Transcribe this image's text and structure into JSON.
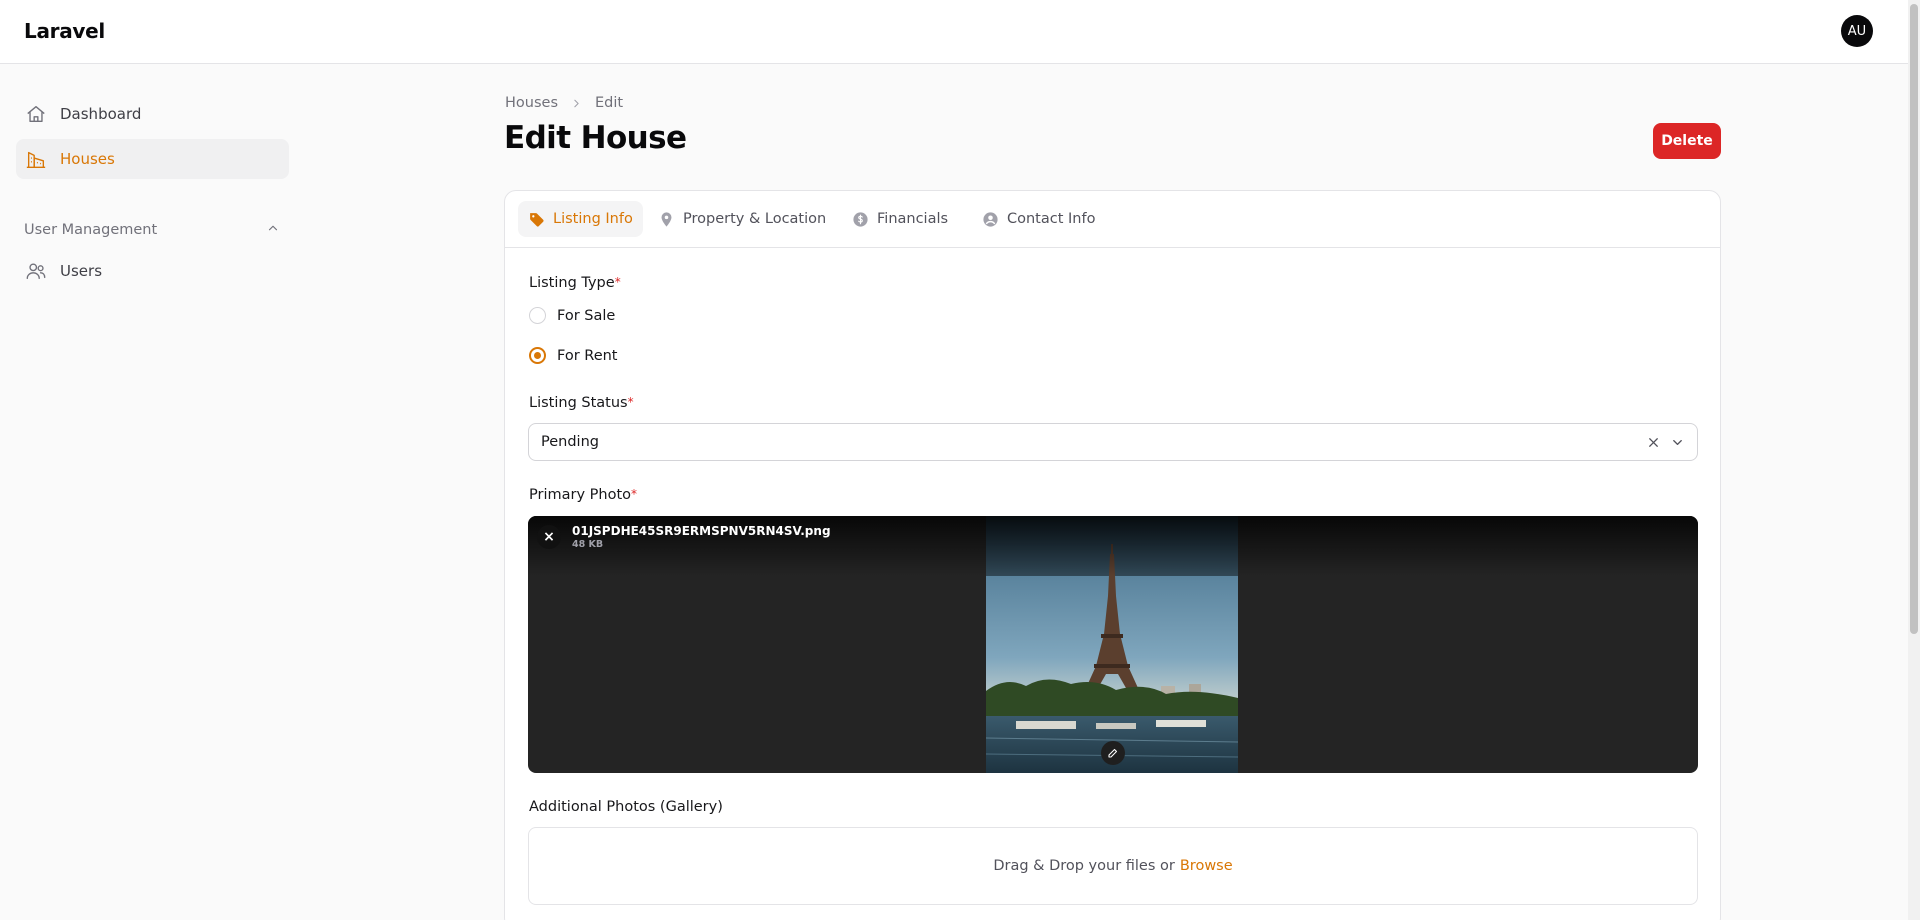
{
  "app": {
    "brand": "Laravel",
    "avatar_initials": "AU"
  },
  "sidebar": {
    "items": [
      {
        "label": "Dashboard",
        "icon": "home-icon",
        "active": false
      },
      {
        "label": "Houses",
        "icon": "building-icon",
        "active": true
      }
    ],
    "groups": [
      {
        "label": "User Management",
        "expanded": true,
        "items": [
          {
            "label": "Users",
            "icon": "users-icon"
          }
        ]
      }
    ]
  },
  "breadcrumb": [
    "Houses",
    "Edit"
  ],
  "page": {
    "title": "Edit House",
    "delete_label": "Delete"
  },
  "tabs": [
    {
      "label": "Listing Info",
      "icon": "tag-icon",
      "active": true
    },
    {
      "label": "Property & Location",
      "icon": "map-pin-icon",
      "active": false
    },
    {
      "label": "Financials",
      "icon": "currency-dollar-icon",
      "active": false
    },
    {
      "label": "Contact Info",
      "icon": "user-circle-icon",
      "active": false
    }
  ],
  "form": {
    "listing_type": {
      "label": "Listing Type",
      "required_mark": "*",
      "options": [
        "For Sale",
        "For Rent"
      ],
      "selected": "For Rent"
    },
    "listing_status": {
      "label": "Listing Status",
      "required_mark": "*",
      "value": "Pending"
    },
    "primary_photo": {
      "label": "Primary Photo",
      "required_mark": "*",
      "file_name": "01JSPDHE45SR9ERMSPNV5RN4SV.png",
      "file_size": "48 KB"
    },
    "gallery": {
      "label": "Additional Photos (Gallery)",
      "drop_text": "Drag & Drop your files or",
      "browse_label": "Browse"
    }
  },
  "colors": {
    "accent": "#d97706",
    "danger": "#dc2626",
    "text": "#18181b",
    "muted": "#71717a"
  }
}
